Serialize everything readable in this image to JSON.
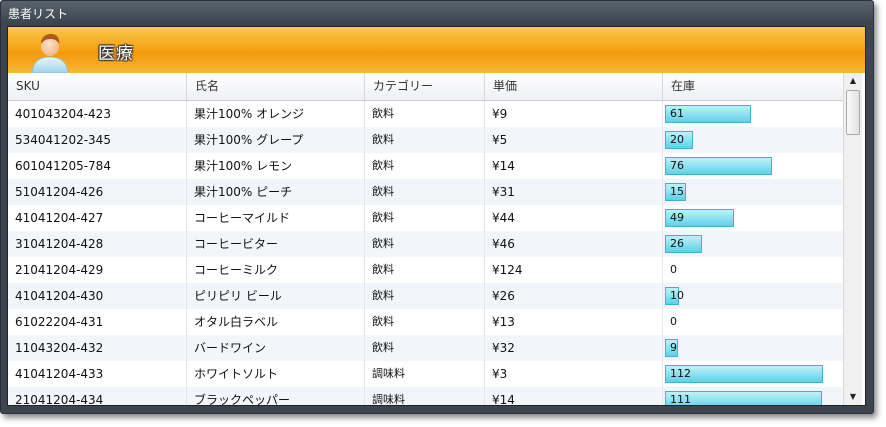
{
  "window": {
    "title": "患者リスト"
  },
  "banner": {
    "title": "医療",
    "avatar_icon": "person-avatar-icon"
  },
  "columns": [
    "SKU",
    "氏名",
    "カテゴリー",
    "単価",
    "在庫"
  ],
  "rows": [
    {
      "sku": "401043204-423",
      "name": "果汁100% オレンジ",
      "category": "飲料",
      "price": "¥9",
      "stock": "61",
      "stock_value": 61
    },
    {
      "sku": "534041202-345",
      "name": "果汁100% グレープ",
      "category": "飲料",
      "price": "¥5",
      "stock": "20",
      "stock_value": 20
    },
    {
      "sku": "601041205-784",
      "name": "果汁100% レモン",
      "category": "飲料",
      "price": "¥14",
      "stock": "76",
      "stock_value": 76
    },
    {
      "sku": "51041204-426",
      "name": "果汁100% ピーチ",
      "category": "飲料",
      "price": "¥31",
      "stock": "15",
      "stock_value": 15
    },
    {
      "sku": "41041204-427",
      "name": "コーヒーマイルド",
      "category": "飲料",
      "price": "¥44",
      "stock": "49",
      "stock_value": 49
    },
    {
      "sku": "31041204-428",
      "name": "コーヒービター",
      "category": "飲料",
      "price": "¥46",
      "stock": "26",
      "stock_value": 26
    },
    {
      "sku": "21041204-429",
      "name": "コーヒーミルク",
      "category": "飲料",
      "price": "¥124",
      "stock": "0",
      "stock_value": 0
    },
    {
      "sku": "41041204-430",
      "name": "ピリピリ ビール",
      "category": "飲料",
      "price": "¥26",
      "stock": "10",
      "stock_value": 10
    },
    {
      "sku": "61022204-431",
      "name": "オタル白ラベル",
      "category": "飲料",
      "price": "¥13",
      "stock": "0",
      "stock_value": 0
    },
    {
      "sku": "11043204-432",
      "name": "バードワイン",
      "category": "飲料",
      "price": "¥32",
      "stock": "9",
      "stock_value": 9
    },
    {
      "sku": "41041204-433",
      "name": "ホワイトソルト",
      "category": "調味料",
      "price": "¥3",
      "stock": "112",
      "stock_value": 112
    },
    {
      "sku": "21041204-434",
      "name": "ブラックペッパー",
      "category": "調味料",
      "price": "¥14",
      "stock": "111",
      "stock_value": 111
    }
  ],
  "stock_bar_max": 112,
  "colors": {
    "banner_accent": "#f6a619",
    "stock_bar": "#5fd0e8",
    "window_frame": "#3d4650"
  }
}
